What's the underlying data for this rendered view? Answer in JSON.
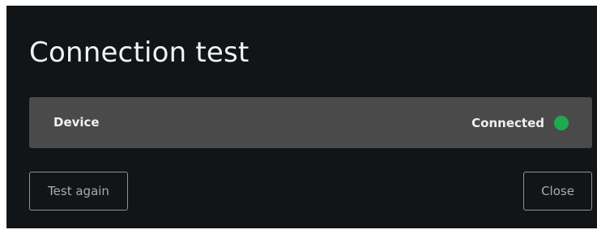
{
  "dialog": {
    "title": "Connection test",
    "device": {
      "label": "Device",
      "status": "Connected",
      "status_color": "#1faa52"
    },
    "buttons": {
      "test_again": "Test again",
      "close": "Close"
    }
  },
  "colors": {
    "background": "#111518",
    "row_background": "#4a4a4a",
    "status_connected": "#1faa52"
  }
}
